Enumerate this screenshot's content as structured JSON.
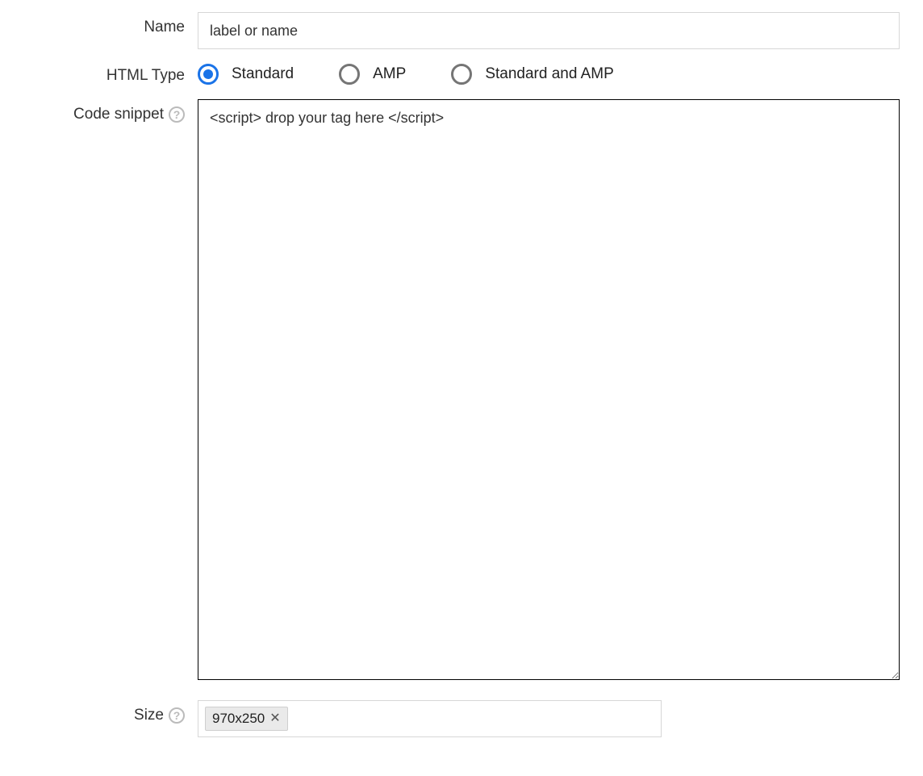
{
  "labels": {
    "name": "Name",
    "html_type": "HTML Type",
    "code_snippet": "Code snippet",
    "size": "Size"
  },
  "name": {
    "value": "label or name"
  },
  "html_type": {
    "options": [
      {
        "label": "Standard",
        "checked": true
      },
      {
        "label": "AMP",
        "checked": false
      },
      {
        "label": "Standard and AMP",
        "checked": false
      }
    ]
  },
  "code_snippet": {
    "placeholder": "<script> drop your tag here </script>",
    "value": ""
  },
  "size": {
    "chips": [
      {
        "label": "970x250"
      }
    ]
  },
  "icons": {
    "help": "?"
  }
}
